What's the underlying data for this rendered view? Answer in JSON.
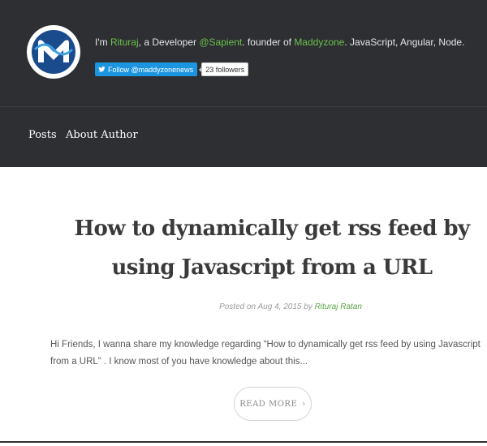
{
  "header": {
    "bio": {
      "intro": "I'm ",
      "author_link": "Rituraj",
      "middle": ", a Developer ",
      "company_link": "@Sapient",
      "founder_text": ". founder of ",
      "site_link": "Maddyzone",
      "tail": ". JavaScript, Angular, Node."
    },
    "twitter": {
      "follow_label": "Follow @maddyzonenews",
      "followers": "23 followers"
    }
  },
  "nav": {
    "items": [
      {
        "label": "Posts"
      },
      {
        "label": "About Author"
      }
    ]
  },
  "post": {
    "title": "How to dynamically get rss feed by using Javascript from a URL",
    "meta_prefix": "Posted on Aug 4, 2015 by ",
    "author": "Rituraj Ratan",
    "excerpt": "Hi Friends, I wanna share my knowledge regarding “How to dynamically get rss feed by using Javascript from a URL” . I know most of you have knowledge about this...",
    "read_more": "READ MORE",
    "read_more_icon": "chevron-right-icon"
  },
  "colors": {
    "header_bg": "#2d2f33",
    "accent_link": "#6cc04a",
    "twitter_blue": "#1b95e0"
  }
}
